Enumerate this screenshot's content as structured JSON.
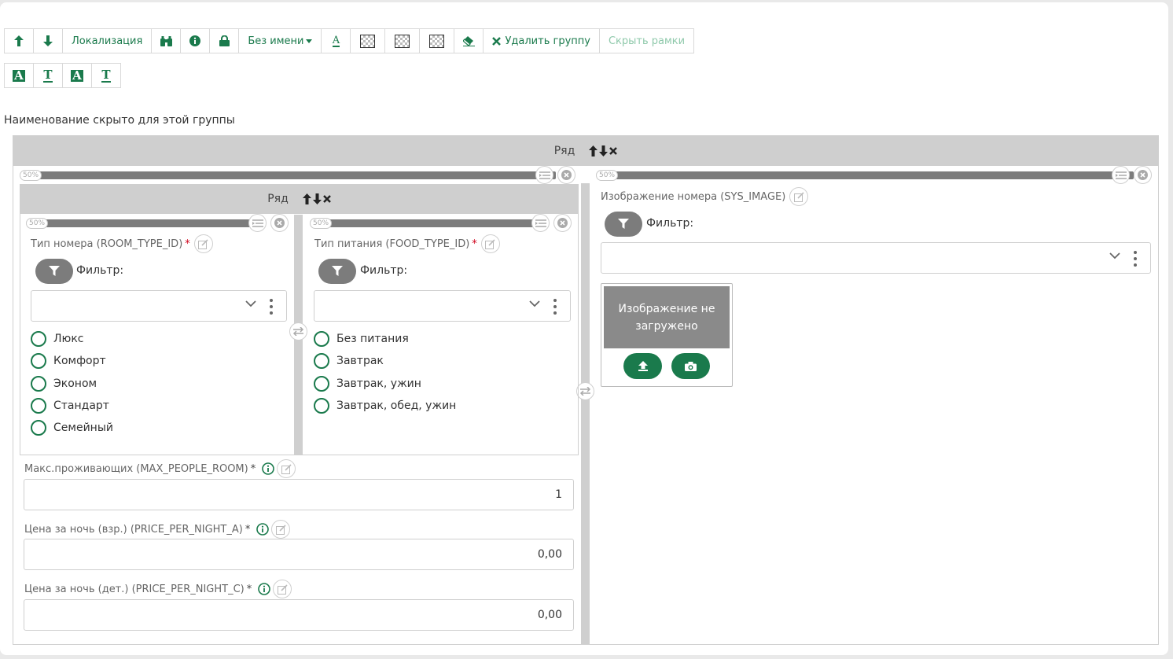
{
  "toolbar": {
    "buttons": [
      {
        "icon": "arrow-up-icon"
      },
      {
        "icon": "arrow-down-icon"
      },
      {
        "label": "Локализация"
      },
      {
        "icon": "binoculars-icon"
      },
      {
        "icon": "info-icon"
      },
      {
        "icon": "lock-icon"
      },
      {
        "label": "Без имени"
      },
      {
        "icon": "font-underline-icon"
      },
      {
        "icon": "checker-pattern-icon"
      },
      {
        "icon": "checker-pattern-icon"
      },
      {
        "icon": "checker-pattern-icon"
      },
      {
        "icon": "eraser-icon"
      },
      {
        "label": "Удалить группу"
      },
      {
        "label": "Скрыть рамки"
      }
    ],
    "format_glyphs": [
      "A",
      "T",
      "A",
      "T"
    ]
  },
  "group_hidden_note": "Наименование скрыто для этой группы",
  "outer_row": {
    "title": "Ряд"
  },
  "left_column": {
    "width_label": "50%"
  },
  "right_column": {
    "width_label": "50%"
  },
  "inner_row": {
    "title": "Ряд"
  },
  "room_type": {
    "width_label": "50%",
    "label": "Тип номера (ROOM_TYPE_ID)",
    "required": "*",
    "filter_label": "Фильтр:",
    "options": [
      "Люкс",
      "Комфорт",
      "Эконом",
      "Стандарт",
      "Семейный"
    ]
  },
  "food_type": {
    "width_label": "50%",
    "label": "Тип питания (FOOD_TYPE_ID)",
    "required": "*",
    "filter_label": "Фильтр:",
    "options": [
      "Без питания",
      "Завтрак",
      "Завтрак, ужин",
      "Завтрак, обед, ужин"
    ]
  },
  "max_people": {
    "label": "Макс.проживающих (MAX_PEOPLE_ROOM)",
    "required": "*",
    "value": "1"
  },
  "price_adult": {
    "label": "Цена за ночь (взр.) (PRICE_PER_NIGHT_A)",
    "required": "*",
    "value": "0,00"
  },
  "price_child": {
    "label": "Цена за ночь (дет.) (PRICE_PER_NIGHT_C)",
    "required": "*",
    "value": "0,00"
  },
  "sys_image": {
    "label": "Изображение номера (SYS_IMAGE)",
    "filter_label": "Фильтр:",
    "placeholder": "Изображение не загружено"
  },
  "colors": {
    "accent": "#1a7a4c",
    "grey_bar": "#7c7c7c",
    "row_head": "#cfcfcf",
    "required": "#d0021b"
  }
}
